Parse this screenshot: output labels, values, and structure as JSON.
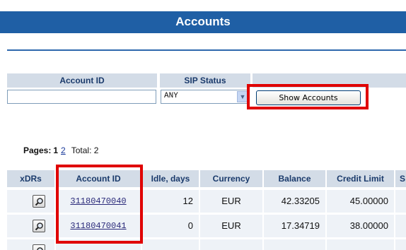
{
  "header": {
    "title": "Accounts"
  },
  "filter": {
    "account_id_label": "Account ID",
    "sip_status_label": "SIP Status",
    "account_id_value": "",
    "sip_status_value": "ANY",
    "show_button_label": "Show Accounts"
  },
  "pager": {
    "label": "Pages:",
    "current_page": "1",
    "other_page": "2",
    "total": "Total: 2"
  },
  "table": {
    "columns": [
      "xDRs",
      "Account ID",
      "Idle, days",
      "Currency",
      "Balance",
      "Credit Limit",
      "S"
    ],
    "rows": [
      {
        "account_id": "31180470040",
        "idle_days": "12",
        "currency": "EUR",
        "balance": "42.33205",
        "credit_limit": "45.00000"
      },
      {
        "account_id": "31180470041",
        "idle_days": "0",
        "currency": "EUR",
        "balance": "17.34719",
        "credit_limit": "38.00000"
      }
    ]
  },
  "colors": {
    "title_bar": "#1f5fa5",
    "header_cell_bg": "#d3dce7",
    "highlight": "#e00000",
    "row_bg": "#eef2f7"
  },
  "icons": {
    "xdr_button": "magnifier-icon",
    "select_arrow": "chevron-down-icon"
  }
}
